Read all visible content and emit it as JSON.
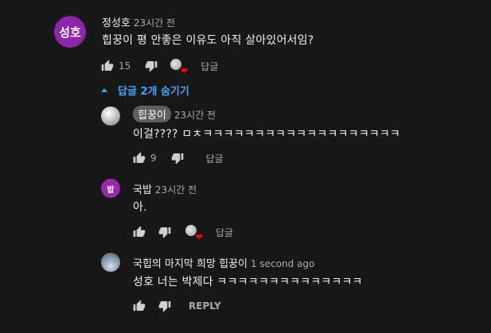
{
  "colors": {
    "background": "#181818",
    "link_blue": "#3ea6ff",
    "heart_red": "#ff0000",
    "avatar_purple": "#8e24aa",
    "avatar_purple2": "#9c27b0"
  },
  "comments": [
    {
      "avatar_text": "성호",
      "author": "정성호",
      "time": "23시간 전",
      "text": "힙꿍이 평 안좋은 이유도 아직 살아있어서임?",
      "likes": "15",
      "reply_label": "답글"
    }
  ],
  "replies_toggle": {
    "icon": "chevron-up-icon",
    "label": "답글 2개 숨기기"
  },
  "replies": [
    {
      "author": "힙꿍이",
      "time": "23시간 전",
      "text": "이걸???? ㅁㅊㅋㅋㅋㅋㅋㅋㅋㅋㅋㅋㅋㅋㅋㅋㅋㅋㅋㅋㅋ",
      "likes": "9",
      "reply_label": "답글"
    },
    {
      "avatar_text": "밥",
      "author": "국밥",
      "time": "23시간 전",
      "text": "아.",
      "reply_label": "답글"
    },
    {
      "author": "국힙의 마지막 희망 힙꿍이",
      "time": "1 second ago",
      "text": "성호 너는 박제다 ㅋㅋㅋㅋㅋㅋㅋㅋㅋㅋㅋㅋㅋㅋ",
      "reply_label": "REPLY"
    }
  ]
}
